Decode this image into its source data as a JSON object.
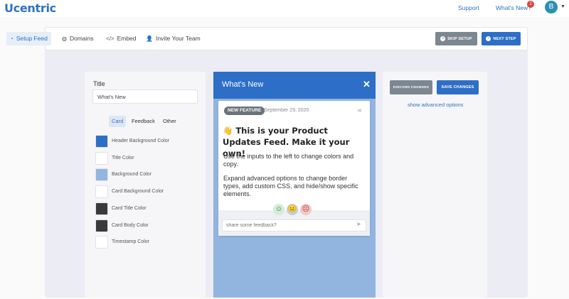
{
  "nav": {
    "brand": "Ucentric",
    "support": "Support",
    "whats_new": "What's New?",
    "notification_count": "2",
    "avatar_initial": "B"
  },
  "tabs": [
    {
      "label": "Setup Feed",
      "icon": "rss-icon",
      "active": true
    },
    {
      "label": "Domains",
      "icon": "globe-icon",
      "active": false
    },
    {
      "label": "Embed",
      "icon": "code-icon",
      "active": false
    },
    {
      "label": "Invite Your Team",
      "icon": "user-plus-icon",
      "active": false
    }
  ],
  "actions": {
    "skip_setup": "SKIP SETUP",
    "next_step": "NEXT STEP"
  },
  "settings": {
    "title_label": "Title",
    "title_value": "What's New",
    "subtabs": [
      "Card",
      "Feedback",
      "Other"
    ],
    "colors": [
      {
        "label": "Header Background Color",
        "color": "#2d6fc6"
      },
      {
        "label": "Title Color",
        "color": "#ffffff"
      },
      {
        "label": "Background Color",
        "color": "#92b5df"
      },
      {
        "label": "Card Background Color",
        "color": "#ffffff"
      },
      {
        "label": "Card Title Color",
        "color": "#3a3a3a"
      },
      {
        "label": "Card Body Color",
        "color": "#3a3a3a"
      },
      {
        "label": "Timestamp Color",
        "color": "#ffffff"
      }
    ]
  },
  "preview": {
    "header_title": "What's New",
    "badge": "NEW FEATURE",
    "date": "September 29, 2020",
    "card_title": "👋 This is your Product Updates Feed. Make it your own!",
    "paragraph1": "Use the inputs to the left to change colors and copy.",
    "paragraph2": "Expand advanced options to change border types, add custom CSS, and hide/show specific elements.",
    "feedback_placeholder": "share some feedback?"
  },
  "right": {
    "discard": "DISCARD CHANGES",
    "save": "SAVE CHANGES",
    "advanced_link": "show advanced options"
  }
}
